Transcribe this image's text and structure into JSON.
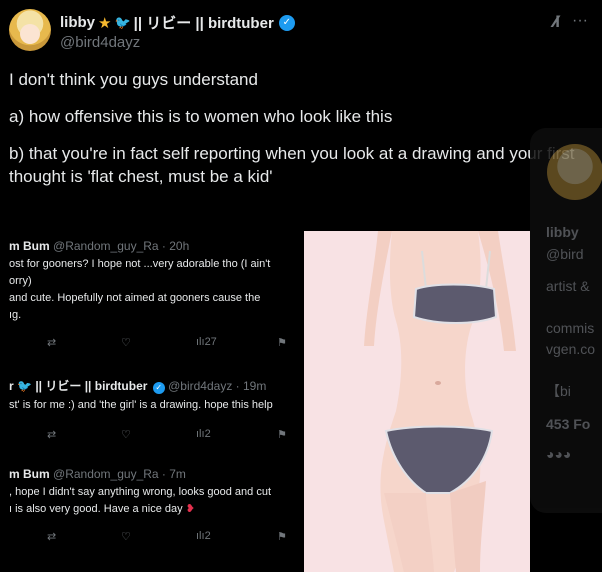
{
  "author": {
    "display_name": "libby",
    "name_suffix": "|| リビー || birdtuber",
    "handle": "@bird4dayz",
    "star_icon": "star-icon",
    "bird_icon": "bird-icon"
  },
  "header_icons": [
    "grok-icon",
    "more-icon"
  ],
  "tweet": {
    "line1": "I don't think you guys understand",
    "line2": "a) how offensive this is to women who look like this",
    "line3": "b) that you're in fact self reporting when you look at a drawing and your first thought is 'flat chest, must be a kid'"
  },
  "background_card": {
    "name": "libby",
    "handle": "@bird",
    "bio1": "artist &",
    "bio2": "commis",
    "bio3": "vgen.co",
    "badge": "bi",
    "followers": "453 Fo"
  },
  "embedded_replies": [
    {
      "name": "m Bum",
      "meta": "@Random_guy_Ra · 20h",
      "lines": [
        "ost for gooners? I hope not ...very adorable tho (I ain't",
        "orry)",
        "and cute. Hopefully not aimed at gooners cause the",
        "ıg."
      ],
      "views": "27"
    },
    {
      "name": "|| リビー || birdtuber",
      "meta": "@bird4dayz · 19m",
      "lines": [
        "st' is for me :) and 'the girl' is a drawing. hope this help"
      ],
      "views": "2"
    },
    {
      "name": "m Bum",
      "meta": "@Random_guy_Ra · 7m",
      "lines": [
        ", hope I didn't say anything wrong, looks good and cut",
        "ı is also very good. Have a nice day"
      ],
      "views": "2"
    }
  ],
  "colors": {
    "background": "#000000",
    "text": "#e7e9ea",
    "muted": "#71767b",
    "verified": "#1d9bf0",
    "artwork_bg": "#f8e2e4",
    "garment": "#5c5a6e"
  }
}
